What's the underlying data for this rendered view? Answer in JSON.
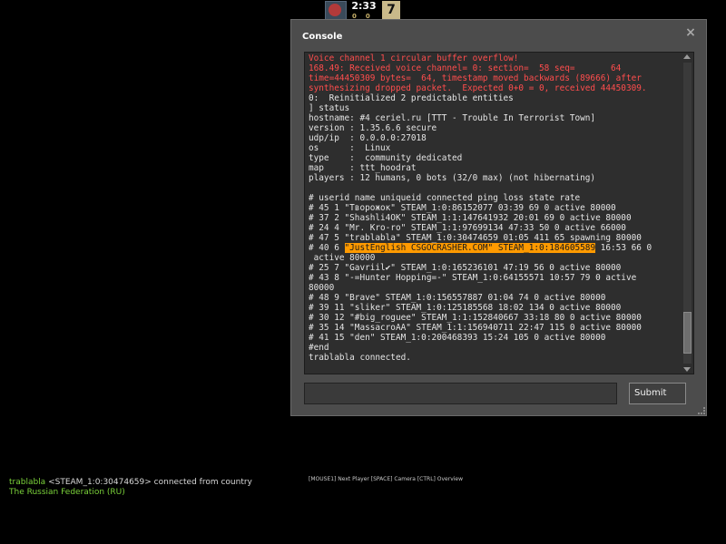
{
  "hud": {
    "timer": "2:33",
    "timer_sub": "00",
    "round": "7"
  },
  "console": {
    "title": "Console",
    "close_glyph": "×",
    "submit_label": "Submit",
    "input_value": "",
    "output": [
      {
        "text": "Voice channel 1 circular buffer overflow!",
        "cls": "red"
      },
      {
        "text": "168.49: Received voice channel= 0: section=  58 seq=       64",
        "cls": "red"
      },
      {
        "text": "time=44450309 bytes=  64, timestamp moved backwards (89666) after",
        "cls": "red"
      },
      {
        "text": "synthesizing dropped packet.  Expected 0+0 = 0, received 44450309.",
        "cls": "red"
      },
      {
        "text": "0:  Reinitialized 2 predictable entities",
        "cls": ""
      },
      {
        "text": "] status",
        "cls": ""
      },
      {
        "text": "hostname: #4 ceriel.ru [TTT - Trouble In Terrorist Town]",
        "cls": ""
      },
      {
        "text": "version : 1.35.6.6 secure",
        "cls": ""
      },
      {
        "text": "udp/ip  : 0.0.0.0:27018",
        "cls": ""
      },
      {
        "text": "os      :  Linux",
        "cls": ""
      },
      {
        "text": "type    :  community dedicated",
        "cls": ""
      },
      {
        "text": "map     : ttt_hoodrat",
        "cls": ""
      },
      {
        "text": "players : 12 humans, 0 bots (32/0 max) (not hibernating)",
        "cls": ""
      },
      {
        "text": "",
        "cls": ""
      },
      {
        "text": "# userid name uniqueid connected ping loss state rate",
        "cls": ""
      },
      {
        "text": "# 45 1 \"Творожок\" STEAM_1:0:86152077 03:39 69 0 active 80000",
        "cls": ""
      },
      {
        "text": "# 37 2 \"Shashli4OK\" STEAM_1:1:147641932 20:01 69 0 active 80000",
        "cls": ""
      },
      {
        "text": "# 24 4 \"Mr. Kro-ro\" STEAM_1:1:97699134 47:33 50 0 active 66000",
        "cls": ""
      },
      {
        "text": "# 47 5 \"trablabla\" STEAM_1:0:30474659 01:05 411 65 spawning 80000",
        "cls": ""
      },
      {
        "pre": "# 40 6 ",
        "hl": "\"JustEnglish CSGOCRASHER.COM\" STEAM_1:0:184605589",
        "post": " 16:53 66 0"
      },
      {
        "text": " active 80000",
        "cls": ""
      },
      {
        "text": "# 25 7 \"Gavriil✔\" STEAM_1:0:165236101 47:19 56 0 active 80000",
        "cls": ""
      },
      {
        "text": "# 43 8 \"-=Hunter Hopping=-\" STEAM_1:0:64155571 10:57 79 0 active",
        "cls": ""
      },
      {
        "text": "80000",
        "cls": ""
      },
      {
        "text": "# 48 9 \"Brave\" STEAM_1:0:156557887 01:04 74 0 active 80000",
        "cls": ""
      },
      {
        "text": "# 39 11 \"sliker\" STEAM_1:0:125185568 18:02 134 0 active 80000",
        "cls": ""
      },
      {
        "text": "# 30 12 \"#big_roguee\" STEAM_1:1:152840667 33:18 80 0 active 80000",
        "cls": ""
      },
      {
        "text": "# 35 14 \"MassacroAA\" STEAM_1:1:156940711 22:47 115 0 active 80000",
        "cls": ""
      },
      {
        "text": "# 41 15 \"den\" STEAM_1:0:200468393 15:24 105 0 active 80000",
        "cls": ""
      },
      {
        "text": "#end",
        "cls": ""
      },
      {
        "text": "trablabla connected.",
        "cls": ""
      }
    ]
  },
  "chat": {
    "player": "trablabla",
    "steam_id": "<STEAM_1:0:30474659>",
    "message": " connected from country",
    "country": "The Russian Federation (RU)"
  },
  "spectator_hint": "[MOUSE1] Next Player [SPACE] Camera  [CTRL] Overview",
  "colors": {
    "error_text": "#ff4d4d",
    "highlight": "#ff9a00",
    "chat_green": "#7bd23a"
  }
}
